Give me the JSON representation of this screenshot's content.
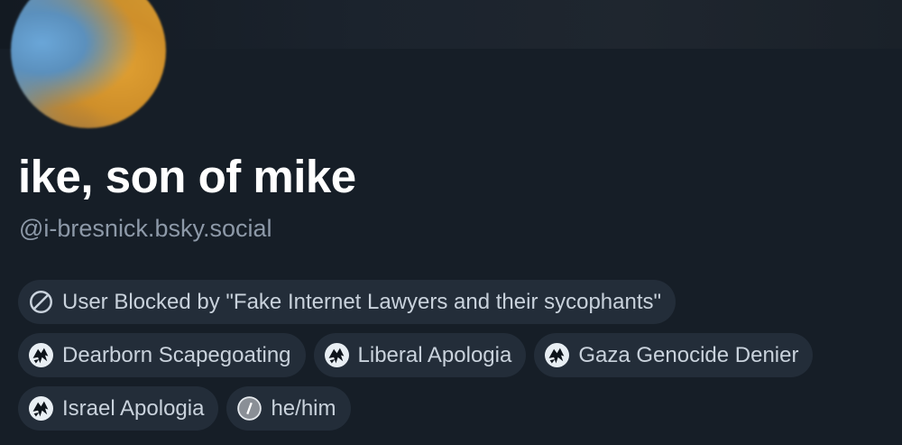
{
  "profile": {
    "display_name": "ike, son of mike",
    "handle": "@i-bresnick.bsky.social"
  },
  "labels": [
    {
      "icon": "blocked-icon",
      "text": "User Blocked by \"Fake Internet Lawyers and their sycophants\""
    },
    {
      "icon": "labeler-avatar-icon",
      "text": "Dearborn Scapegoating"
    },
    {
      "icon": "labeler-avatar-icon",
      "text": "Liberal Apologia"
    },
    {
      "icon": "labeler-avatar-icon",
      "text": "Gaza Genocide Denier"
    },
    {
      "icon": "labeler-avatar-icon",
      "text": "Israel Apologia"
    },
    {
      "icon": "pronouns-labeler-icon",
      "text": "he/him"
    }
  ],
  "colors": {
    "background": "#161e27",
    "pill_background": "#232d39",
    "name_text": "#ffffff",
    "handle_text": "#8d99a8",
    "pill_text": "#c9d2dc"
  }
}
